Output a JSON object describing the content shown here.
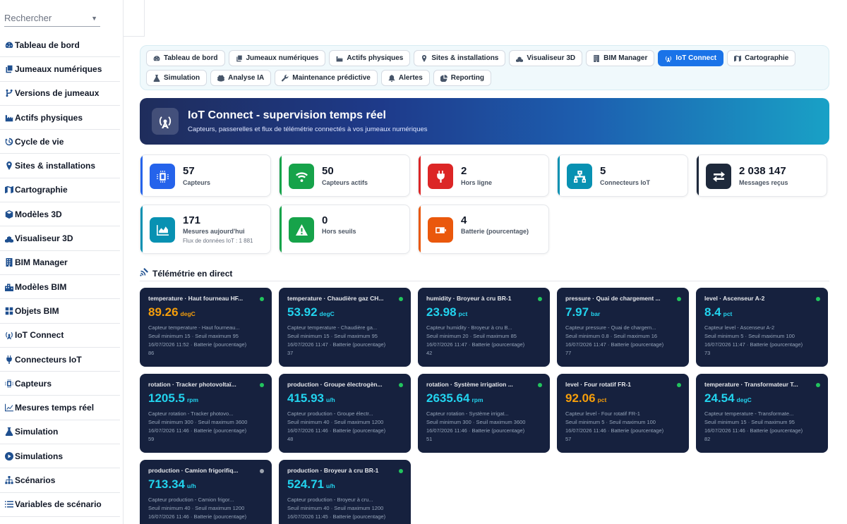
{
  "search": {
    "placeholder": "Rechercher"
  },
  "sidebar": {
    "items": [
      {
        "label": "Tableau de bord",
        "icon": "dashboard-icon"
      },
      {
        "label": "Jumeaux numériques",
        "icon": "copy-icon"
      },
      {
        "label": "Versions de jumeaux",
        "icon": "branch-icon"
      },
      {
        "label": "Actifs physiques",
        "icon": "industry-icon"
      },
      {
        "label": "Cycle de vie",
        "icon": "history-icon"
      },
      {
        "label": "Sites & installations",
        "icon": "map-pin-icon"
      },
      {
        "label": "Cartographie",
        "icon": "map-icon"
      },
      {
        "label": "Modèles 3D",
        "icon": "cube-icon"
      },
      {
        "label": "Visualiseur 3D",
        "icon": "cubes-icon"
      },
      {
        "label": "BIM Manager",
        "icon": "building-icon"
      },
      {
        "label": "Modèles BIM",
        "icon": "city-icon"
      },
      {
        "label": "Objets BIM",
        "icon": "grid-icon"
      },
      {
        "label": "IoT Connect",
        "icon": "broadcast-icon"
      },
      {
        "label": "Connecteurs IoT",
        "icon": "plug-icon"
      },
      {
        "label": "Capteurs",
        "icon": "chip-icon"
      },
      {
        "label": "Mesures temps réel",
        "icon": "chart-line-icon"
      },
      {
        "label": "Simulation",
        "icon": "flask-icon"
      },
      {
        "label": "Simulations",
        "icon": "play-circle-icon"
      },
      {
        "label": "Scénarios",
        "icon": "sitemap-icon"
      },
      {
        "label": "Variables de scénario",
        "icon": "list-icon"
      }
    ]
  },
  "tabs": [
    {
      "label": "Tableau de bord",
      "icon": "dashboard-icon",
      "active": false
    },
    {
      "label": "Jumeaux numériques",
      "icon": "copy-icon",
      "active": false
    },
    {
      "label": "Actifs physiques",
      "icon": "industry-icon",
      "active": false
    },
    {
      "label": "Sites & installations",
      "icon": "map-pin-icon",
      "active": false
    },
    {
      "label": "Visualiseur 3D",
      "icon": "cubes-icon",
      "active": false
    },
    {
      "label": "BIM Manager",
      "icon": "building-icon",
      "active": false
    },
    {
      "label": "IoT Connect",
      "icon": "broadcast-icon",
      "active": true
    },
    {
      "label": "Cartographie",
      "icon": "map-icon",
      "active": false
    },
    {
      "label": "Simulation",
      "icon": "flask-icon",
      "active": false
    },
    {
      "label": "Analyse IA",
      "icon": "brain-icon",
      "active": false
    },
    {
      "label": "Maintenance prédictive",
      "icon": "tools-icon",
      "active": false
    },
    {
      "label": "Alertes",
      "icon": "bell-icon",
      "active": false
    },
    {
      "label": "Reporting",
      "icon": "pie-icon",
      "active": false
    }
  ],
  "hero": {
    "title": "IoT Connect - supervision temps réel",
    "subtitle": "Capteurs, passerelles et flux de télémétrie connectés à vos jumeaux numériques",
    "icon": "broadcast-icon"
  },
  "stats": [
    {
      "value": "57",
      "label": "Capteurs",
      "sub": "",
      "icon": "chip-icon",
      "color": "#2563eb"
    },
    {
      "value": "50",
      "label": "Capteurs actifs",
      "sub": "",
      "icon": "wifi-icon",
      "color": "#16a34a"
    },
    {
      "value": "2",
      "label": "Hors ligne",
      "sub": "",
      "icon": "plug-icon",
      "color": "#dc2626"
    },
    {
      "value": "5",
      "label": "Connecteurs IoT",
      "sub": "",
      "icon": "network-icon",
      "color": "#0891b2"
    },
    {
      "value": "2 038 147",
      "label": "Messages reçus",
      "sub": "",
      "icon": "exchange-icon",
      "color": "#1e293b"
    },
    {
      "value": "171",
      "label": "Mesures aujourd'hui",
      "sub": "Flux de données IoT : 1 881",
      "icon": "chart-area-icon",
      "color": "#0891b2"
    },
    {
      "value": "0",
      "label": "Hors seuils",
      "sub": "",
      "icon": "warning-icon",
      "color": "#16a34a"
    },
    {
      "value": "4",
      "label": "Batterie (pourcentage)",
      "sub": "",
      "icon": "battery-icon",
      "color": "#ea580c"
    }
  ],
  "telemetry_title": "Télémétrie en direct",
  "telemetry": [
    {
      "title": "temperature · Haut fourneau HF...",
      "value": "89.26",
      "unit": "degC",
      "color": "orange",
      "online": true,
      "capteur": "Capteur temperature - Haut fourneau...",
      "seuils": "Seuil minimum 15 · Seuil maximum 95",
      "time": "16/07/2026 11:52 · Batterie (pourcentage)",
      "battery": "86"
    },
    {
      "title": "temperature · Chaudière gaz CH...",
      "value": "53.92",
      "unit": "degC",
      "color": "cyan",
      "online": true,
      "capteur": "Capteur temperature - Chaudière ga...",
      "seuils": "Seuil minimum 15 · Seuil maximum 95",
      "time": "16/07/2026 11:47 · Batterie (pourcentage)",
      "battery": "37"
    },
    {
      "title": "humidity · Broyeur à cru BR-1",
      "value": "23.98",
      "unit": "pct",
      "color": "cyan",
      "online": true,
      "capteur": "Capteur humidity - Broyeur à cru B...",
      "seuils": "Seuil minimum 20 · Seuil maximum 85",
      "time": "16/07/2026 11:47 · Batterie (pourcentage)",
      "battery": "42"
    },
    {
      "title": "pressure · Quai de chargement ...",
      "value": "7.97",
      "unit": "bar",
      "color": "cyan",
      "online": true,
      "capteur": "Capteur pressure - Quai de chargem...",
      "seuils": "Seuil minimum 0.8 · Seuil maximum 16",
      "time": "16/07/2026 11:47 · Batterie (pourcentage)",
      "battery": "77"
    },
    {
      "title": "level · Ascenseur A-2",
      "value": "8.4",
      "unit": "pct",
      "color": "cyan",
      "online": true,
      "capteur": "Capteur level - Ascenseur A-2",
      "seuils": "Seuil minimum 5 · Seuil maximum 100",
      "time": "16/07/2026 11:47 · Batterie (pourcentage)",
      "battery": "73"
    },
    {
      "title": "rotation · Tracker photovoltaï...",
      "value": "1205.5",
      "unit": "rpm",
      "color": "cyan",
      "online": true,
      "capteur": "Capteur rotation - Tracker photovo...",
      "seuils": "Seuil minimum 300 · Seuil maximum 3600",
      "time": "16/07/2026 11:46 · Batterie (pourcentage)",
      "battery": "59"
    },
    {
      "title": "production · Groupe électrogèn...",
      "value": "415.93",
      "unit": "u/h",
      "color": "cyan",
      "online": true,
      "capteur": "Capteur production - Groupe électr...",
      "seuils": "Seuil minimum 40 · Seuil maximum 1200",
      "time": "16/07/2026 11:46 · Batterie (pourcentage)",
      "battery": "48"
    },
    {
      "title": "rotation · Système irrigation ...",
      "value": "2635.64",
      "unit": "rpm",
      "color": "cyan",
      "online": true,
      "capteur": "Capteur rotation - Système irrigat...",
      "seuils": "Seuil minimum 300 · Seuil maximum 3600",
      "time": "16/07/2026 11:46 · Batterie (pourcentage)",
      "battery": "51"
    },
    {
      "title": "level · Four rotatif FR-1",
      "value": "92.06",
      "unit": "pct",
      "color": "orange",
      "online": true,
      "capteur": "Capteur level - Four rotatif FR-1",
      "seuils": "Seuil minimum 5 · Seuil maximum 100",
      "time": "16/07/2026 11:46 · Batterie (pourcentage)",
      "battery": "57"
    },
    {
      "title": "temperature · Transformateur T...",
      "value": "24.54",
      "unit": "degC",
      "color": "cyan",
      "online": true,
      "capteur": "Capteur temperature - Transformate...",
      "seuils": "Seuil minimum 15 · Seuil maximum 95",
      "time": "16/07/2026 11:46 · Batterie (pourcentage)",
      "battery": "82"
    },
    {
      "title": "production · Camion frigorifiq...",
      "value": "713.34",
      "unit": "u/h",
      "color": "cyan",
      "online": false,
      "capteur": "Capteur production - Camion frigor...",
      "seuils": "Seuil minimum 40 · Seuil maximum 1200",
      "time": "16/07/2026 11:46 · Batterie (pourcentage)",
      "battery": ""
    },
    {
      "title": "production · Broyeur à cru BR-1",
      "value": "524.71",
      "unit": "u/h",
      "color": "cyan",
      "online": true,
      "capteur": "Capteur production - Broyeur à cru...",
      "seuils": "Seuil minimum 40 · Seuil maximum 1200",
      "time": "16/07/2026 11:45 · Batterie (pourcentage)",
      "battery": ""
    }
  ]
}
